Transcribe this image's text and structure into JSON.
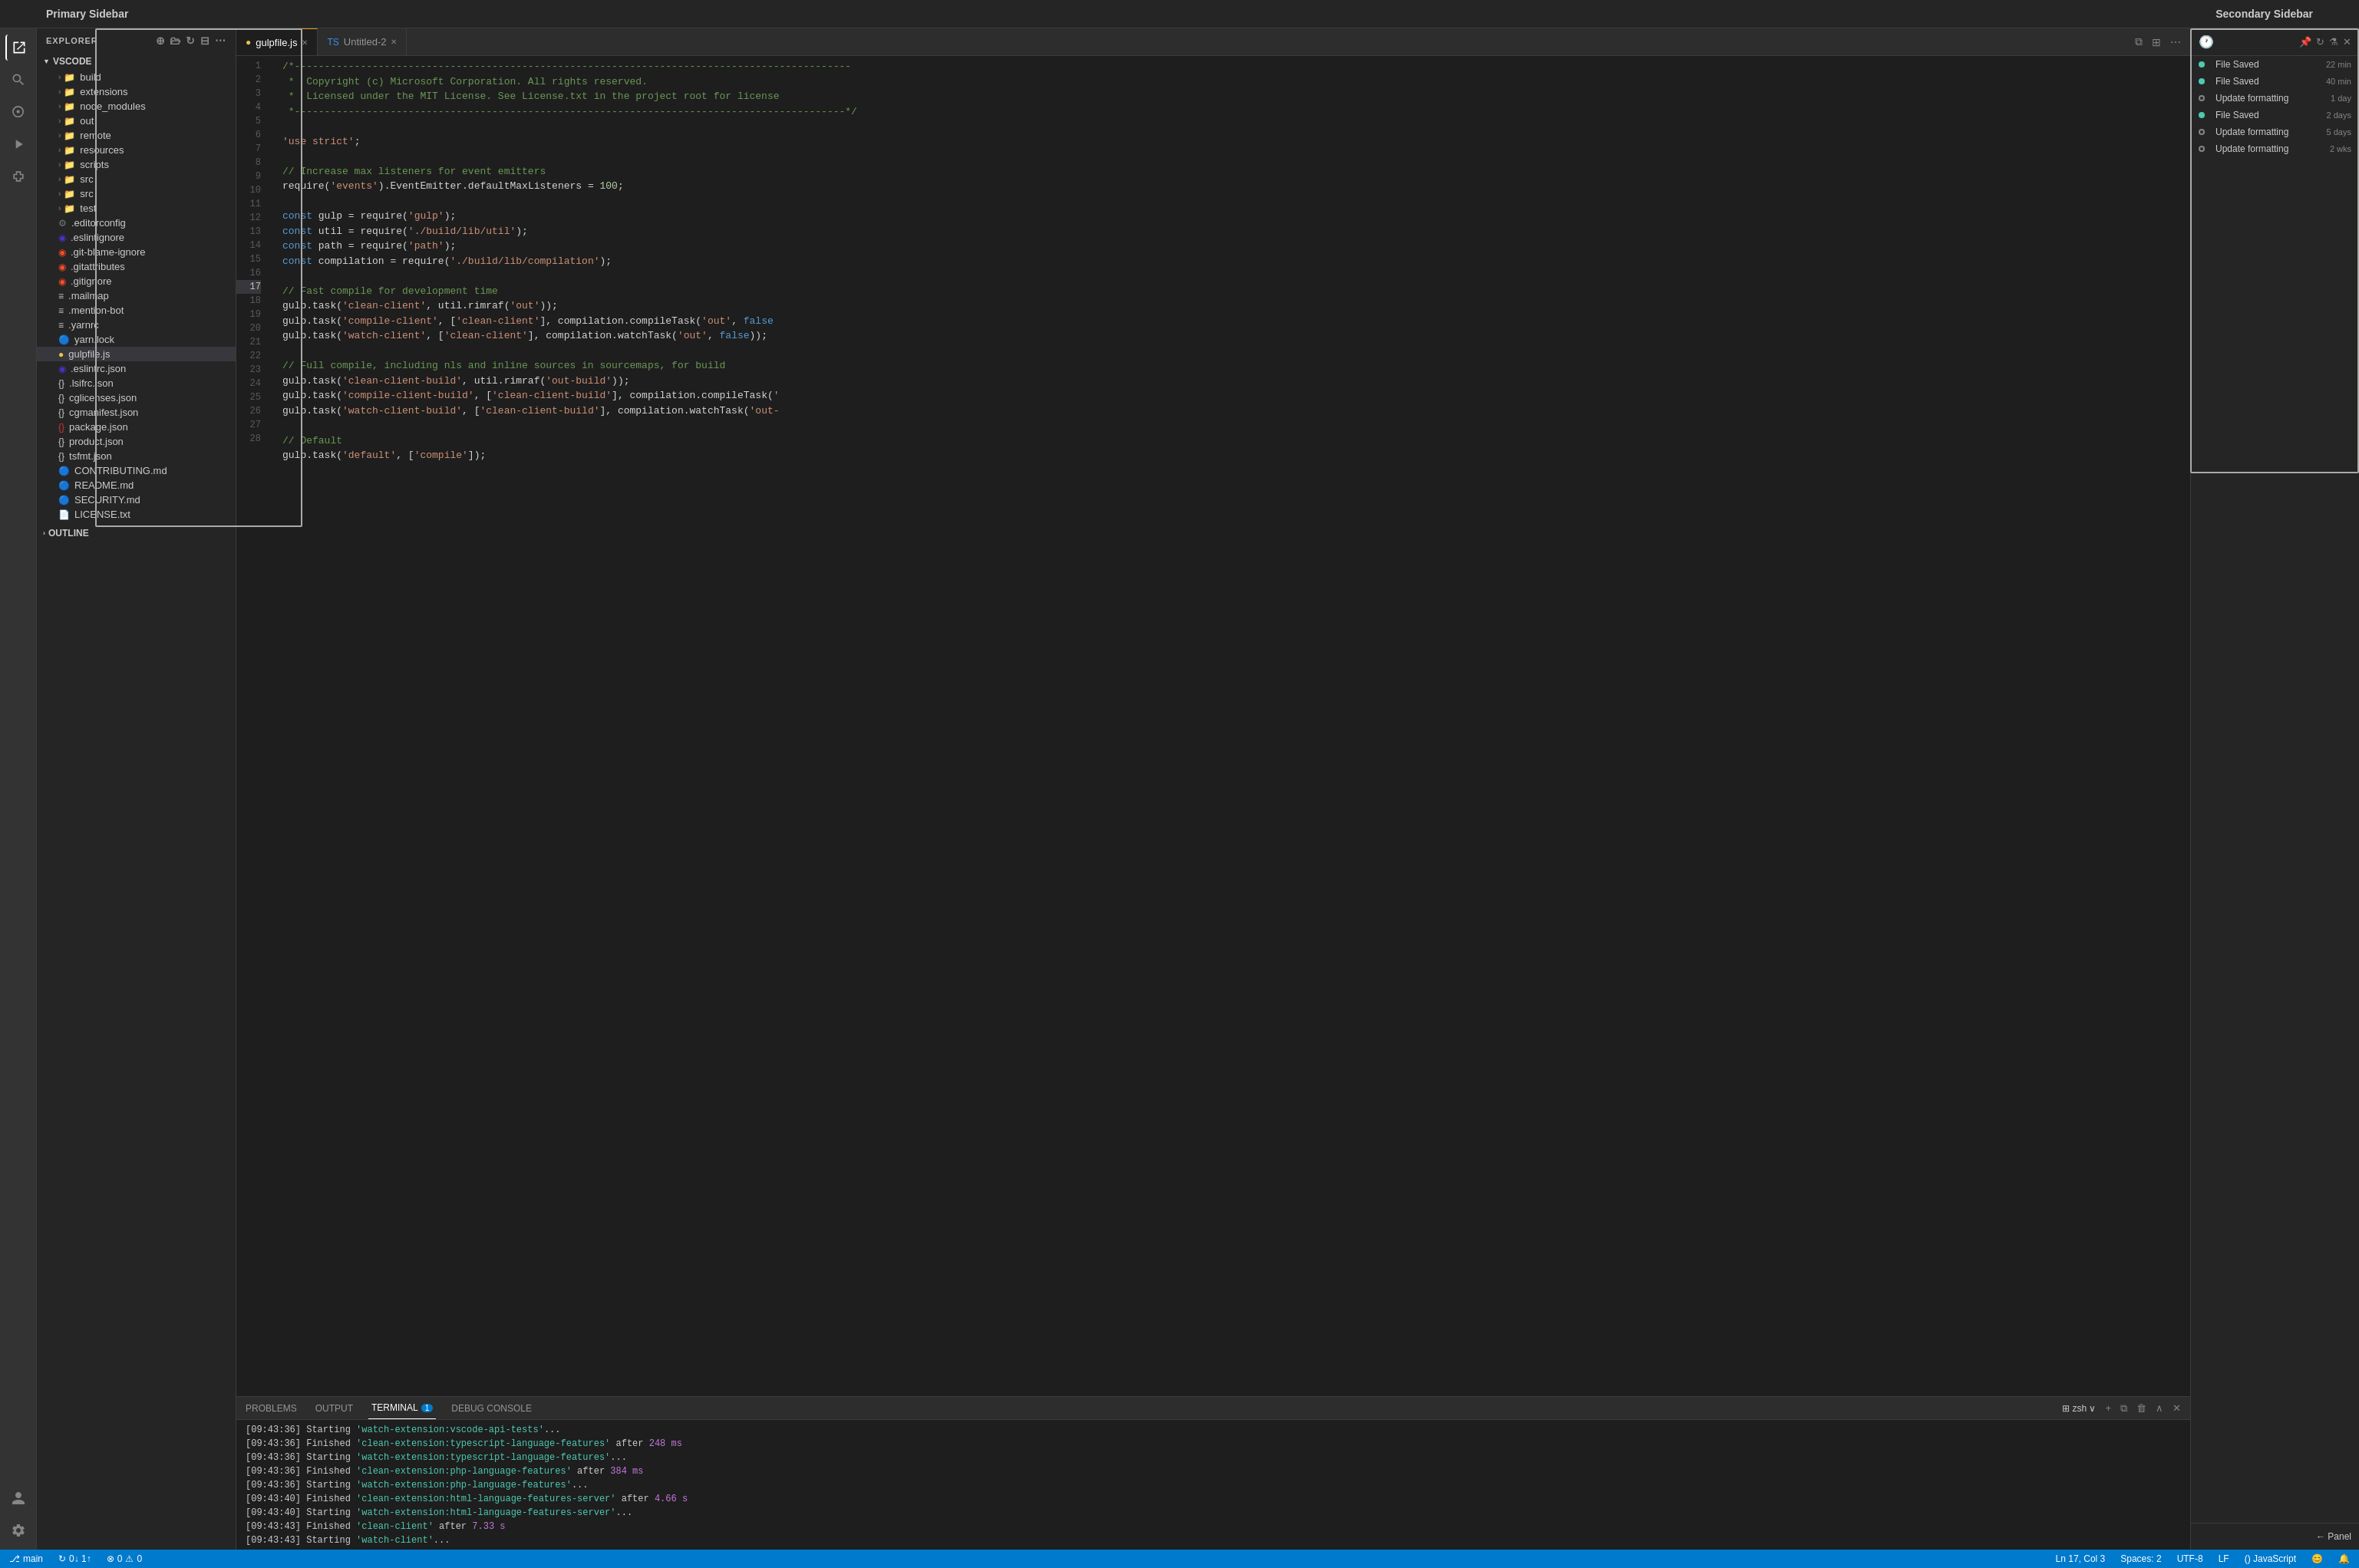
{
  "topLabels": {
    "primary": "Primary Sidebar",
    "secondary": "Secondary Sidebar"
  },
  "activityBar": {
    "icons": [
      {
        "name": "explorer-icon",
        "symbol": "⎘",
        "active": true
      },
      {
        "name": "search-icon",
        "symbol": "🔍",
        "active": false
      },
      {
        "name": "source-control-icon",
        "symbol": "⎇",
        "active": false
      },
      {
        "name": "run-debug-icon",
        "symbol": "▷",
        "active": false
      },
      {
        "name": "extensions-icon",
        "symbol": "⊞",
        "active": false
      }
    ],
    "bottomIcons": [
      {
        "name": "accounts-icon",
        "symbol": "👤"
      },
      {
        "name": "settings-icon",
        "symbol": "⚙"
      }
    ]
  },
  "sidebar": {
    "title": "EXPLORER",
    "headerIcons": [
      "new-file-icon",
      "new-folder-icon",
      "refresh-icon",
      "collapse-icon"
    ],
    "rootSection": "VSCODE",
    "items": [
      {
        "label": "build",
        "type": "folder",
        "depth": 1,
        "expanded": false
      },
      {
        "label": "extensions",
        "type": "folder",
        "depth": 1,
        "expanded": false
      },
      {
        "label": "node_modules",
        "type": "folder",
        "depth": 1,
        "expanded": false
      },
      {
        "label": "out",
        "type": "folder",
        "depth": 1,
        "expanded": false
      },
      {
        "label": "remote",
        "type": "folder",
        "depth": 1,
        "expanded": false
      },
      {
        "label": "resources",
        "type": "folder",
        "depth": 1,
        "expanded": false
      },
      {
        "label": "scripts",
        "type": "folder",
        "depth": 1,
        "expanded": false
      },
      {
        "label": "src",
        "type": "folder",
        "depth": 1,
        "expanded": false
      },
      {
        "label": "src",
        "type": "folder",
        "depth": 1,
        "expanded": false
      },
      {
        "label": "test",
        "type": "folder",
        "depth": 1,
        "expanded": false
      },
      {
        "label": ".editorconfig",
        "type": "settings",
        "depth": 1
      },
      {
        "label": ".eslintignore",
        "type": "eslint",
        "depth": 1
      },
      {
        "label": ".git-blame-ignore",
        "type": "git",
        "depth": 1
      },
      {
        "label": ".gitattributes",
        "type": "git",
        "depth": 1
      },
      {
        "label": ".gitignore",
        "type": "git",
        "depth": 1
      },
      {
        "label": ".mailmap",
        "type": "text",
        "depth": 1
      },
      {
        "label": ".mention-bot",
        "type": "text",
        "depth": 1
      },
      {
        "label": ".yarnrc",
        "type": "text",
        "depth": 1
      },
      {
        "label": "yarn.lock",
        "type": "yarn",
        "depth": 1
      },
      {
        "label": "gulpfile.js",
        "type": "js",
        "depth": 1,
        "active": true
      },
      {
        "label": ".eslintrc.json",
        "type": "eslint",
        "depth": 1
      },
      {
        "label": ".lsifrc.json",
        "type": "json",
        "depth": 1
      },
      {
        "label": "cglicenses.json",
        "type": "json",
        "depth": 1
      },
      {
        "label": "cgmanifest.json",
        "type": "json",
        "depth": 1
      },
      {
        "label": "package.json",
        "type": "npm",
        "depth": 1
      },
      {
        "label": "product.json",
        "type": "json",
        "depth": 1
      },
      {
        "label": "tsfmt.json",
        "type": "json",
        "depth": 1
      },
      {
        "label": "CONTRIBUTING.md",
        "type": "md",
        "depth": 1
      },
      {
        "label": "README.md",
        "type": "md",
        "depth": 1
      },
      {
        "label": "SECURITY.md",
        "type": "md",
        "depth": 1
      },
      {
        "label": "LICENSE.txt",
        "type": "text",
        "depth": 1
      }
    ],
    "outline": "OUTLINE"
  },
  "tabs": [
    {
      "label": "gulpfile.js",
      "type": "js",
      "active": true,
      "dirty": false
    },
    {
      "label": "Untitled-2",
      "type": "ts",
      "active": false,
      "dirty": false
    }
  ],
  "tabBarActions": [
    "split-editor-icon",
    "editor-layout-icon",
    "more-icon"
  ],
  "editor": {
    "lines": [
      {
        "n": 1,
        "code": "/*---------------------------------------------------------------------------------------------"
      },
      {
        "n": 2,
        "code": " *  Copyright (c) Microsoft Corporation. All rights reserved."
      },
      {
        "n": 3,
        "code": " *  Licensed under the MIT License. See License.txt in the project root for license"
      },
      {
        "n": 4,
        "code": " *--------------------------------------------------------------------------------------------*/"
      },
      {
        "n": 5,
        "code": ""
      },
      {
        "n": 6,
        "code": "'use strict';"
      },
      {
        "n": 7,
        "code": ""
      },
      {
        "n": 8,
        "code": "// Increase max listeners for event emitters"
      },
      {
        "n": 9,
        "code": "require('events').EventEmitter.defaultMaxListeners = 100;"
      },
      {
        "n": 10,
        "code": ""
      },
      {
        "n": 11,
        "code": "const gulp = require('gulp');"
      },
      {
        "n": 12,
        "code": "const util = require('./build/lib/util');"
      },
      {
        "n": 13,
        "code": "const path = require('path');"
      },
      {
        "n": 14,
        "code": "const compilation = require('./build/lib/compilation');"
      },
      {
        "n": 15,
        "code": ""
      },
      {
        "n": 16,
        "code": "// Fast compile for development time"
      },
      {
        "n": 17,
        "code": "gulp.task('clean-client', util.rimraf('out'));"
      },
      {
        "n": 18,
        "code": "gulp.task('compile-client', ['clean-client'], compilation.compileTask('out', false"
      },
      {
        "n": 19,
        "code": "gulp.task('watch-client', ['clean-client'], compilation.watchTask('out', false));"
      },
      {
        "n": 20,
        "code": ""
      },
      {
        "n": 21,
        "code": "// Full compile, including nls and inline sources in sourcemaps, for build"
      },
      {
        "n": 22,
        "code": "gulp.task('clean-client-build', util.rimraf('out-build'));"
      },
      {
        "n": 23,
        "code": "gulp.task('compile-client-build', ['clean-client-build'], compilation.compileTask('"
      },
      {
        "n": 24,
        "code": "gulp.task('watch-client-build', ['clean-client-build'], compilation.watchTask('out-"
      },
      {
        "n": 25,
        "code": ""
      },
      {
        "n": 26,
        "code": "// Default"
      },
      {
        "n": 27,
        "code": "gulp.task('default', ['compile']);"
      },
      {
        "n": 28,
        "code": ""
      }
    ]
  },
  "panel": {
    "tabs": [
      {
        "label": "PROBLEMS",
        "active": false,
        "badge": null
      },
      {
        "label": "OUTPUT",
        "active": false,
        "badge": null
      },
      {
        "label": "TERMINAL",
        "active": true,
        "badge": "1"
      },
      {
        "label": "DEBUG CONSOLE",
        "active": false,
        "badge": null
      }
    ],
    "terminalShell": "zsh",
    "terminalLines": [
      {
        "time": "09:43:36",
        "text": "Starting 'watch-extension:vscode-api-tests'..."
      },
      {
        "time": "09:43:36",
        "text": "Finished ",
        "highlight": "'clean-extension:typescript-language-features'",
        "suffix": " after ",
        "ms": "248 ms"
      },
      {
        "time": "09:43:36",
        "text": "Starting 'watch-extension:typescript-language-features'..."
      },
      {
        "time": "09:43:36",
        "text": "Finished ",
        "highlight": "'clean-extension:php-language-features'",
        "suffix": " after ",
        "ms": "384 ms"
      },
      {
        "time": "09:43:36",
        "text": "Starting 'watch-extension:php-language-features'..."
      },
      {
        "time": "09:43:40",
        "text": "Finished ",
        "highlight": "'clean-extension:html-language-features-server'",
        "suffix": " after ",
        "ms": "4.66 s"
      },
      {
        "time": "09:43:40",
        "text": "Starting 'watch-extension:html-language-features-server'..."
      },
      {
        "time": "09:43:43",
        "text": "Finished ",
        "highlight": "'clean-client'",
        "suffix": " after ",
        "ms": "7.33 s"
      },
      {
        "time": "09:43:43",
        "text": "Starting 'watch-client'..."
      }
    ]
  },
  "secondarySidebar": {
    "headerIcons": [
      "pin-icon",
      "refresh-icon",
      "filter-icon",
      "close-icon"
    ],
    "timelineItems": [
      {
        "type": "saved",
        "label": "File Saved",
        "time": "22 min"
      },
      {
        "type": "saved",
        "label": "File Saved",
        "time": "40 min"
      },
      {
        "type": "git",
        "label": "Update formatting",
        "time": "1 day"
      },
      {
        "type": "saved",
        "label": "File Saved",
        "time": "2 days"
      },
      {
        "type": "git",
        "label": "Update formatting",
        "time": "5 days"
      },
      {
        "type": "git",
        "label": "Update formatting",
        "time": "2 wks"
      }
    ]
  },
  "statusBar": {
    "left": [
      {
        "icon": "branch-icon",
        "text": "main"
      },
      {
        "icon": "sync-icon",
        "text": "0↓ 1↑"
      },
      {
        "icon": "error-icon",
        "text": "0"
      },
      {
        "icon": "warning-icon",
        "text": "0"
      }
    ],
    "right": [
      {
        "text": "Ln 17, Col 3"
      },
      {
        "text": "Spaces: 2"
      },
      {
        "text": "UTF-8"
      },
      {
        "text": "LF"
      },
      {
        "text": "() JavaScript"
      },
      {
        "icon": "feedback-icon",
        "text": ""
      },
      {
        "icon": "bell-icon",
        "text": ""
      }
    ]
  }
}
